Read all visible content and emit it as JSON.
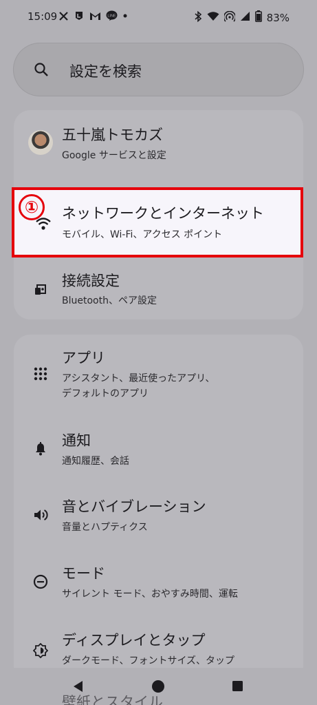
{
  "status_bar": {
    "time": "15:09",
    "battery": "83%",
    "left_icons": [
      "x-icon",
      "line-l-icon",
      "gmail-icon",
      "line-chat-icon",
      "dot-icon"
    ],
    "right_icons": [
      "bluetooth-icon",
      "wifi-icon",
      "hotspot-icon",
      "signal-icon",
      "battery-icon"
    ]
  },
  "search": {
    "placeholder": "設定を検索"
  },
  "account": {
    "name": "五十嵐トモカズ",
    "subtitle": "Google サービスと設定"
  },
  "items": [
    {
      "title": "ネットワークとインターネット",
      "sub": "モバイル、Wi-Fi、アクセス ポイント",
      "icon": "wifi-icon"
    },
    {
      "title": "接続設定",
      "sub": "Bluetooth、ペア設定",
      "icon": "connected-devices-icon"
    },
    {
      "title": "アプリ",
      "sub": "アシスタント、最近使ったアプリ、",
      "sub2": "デフォルトのアプリ",
      "icon": "apps-grid-icon"
    },
    {
      "title": "通知",
      "sub": "通知履歴、会話",
      "icon": "bell-icon"
    },
    {
      "title": "音とバイブレーション",
      "sub": "音量とハプティクス",
      "icon": "volume-icon"
    },
    {
      "title": "モード",
      "sub": "サイレント モード、おやすみ時間、運転",
      "icon": "mode-icon"
    },
    {
      "title": "ディスプレイとタップ",
      "sub": "ダークモード、フォントサイズ、タップ",
      "icon": "display-icon"
    },
    {
      "title": "壁紙とスタイル",
      "icon": "wallpaper-icon"
    }
  ],
  "annotation": {
    "number": "①",
    "color": "#e5000b"
  },
  "nav": {
    "icons": [
      "back-icon",
      "home-icon",
      "recents-icon"
    ]
  }
}
